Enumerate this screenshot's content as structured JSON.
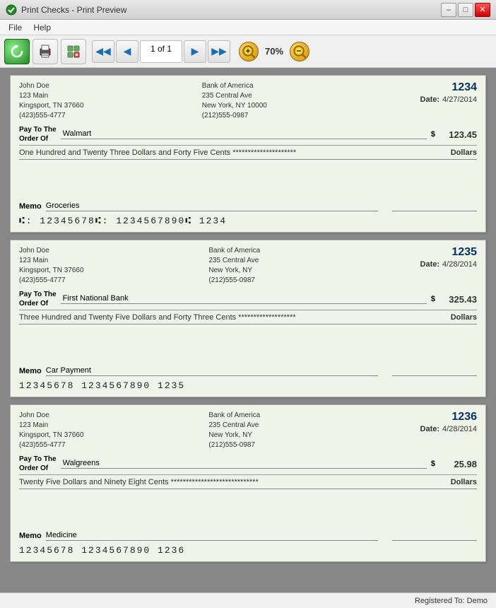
{
  "window": {
    "title": "Print Checks - Print Preview",
    "min_label": "–",
    "max_label": "□",
    "close_label": "✕"
  },
  "menu": {
    "file": "File",
    "help": "Help"
  },
  "toolbar": {
    "page_indicator": "1 of 1",
    "zoom_label": "70%"
  },
  "checks": [
    {
      "sender_name": "John Doe",
      "sender_address1": "123 Main",
      "sender_city": "Kingsport, TN 37660",
      "sender_phone": "(423)555-4777",
      "bank_name": "Bank of America",
      "bank_address1": "235 Central Ave",
      "bank_city": "New York, NY 10000",
      "bank_phone": "(212)555-0987",
      "check_number": "1234",
      "date_label": "Date:",
      "date_value": "4/27/2014",
      "pay_to_label": "Pay To The",
      "order_of_label": "Order Of",
      "payee": "Walmart",
      "dollar_sign": "$",
      "amount": "123.45",
      "written_amount": "One Hundred and Twenty Three Dollars and Forty Five Cents ********************* ",
      "dollars_label": "Dollars",
      "memo_label": "Memo",
      "memo_value": "Groceries",
      "micr": "⑆: 12345678⑆: 1234567890⑆ 1234"
    },
    {
      "sender_name": "John Doe",
      "sender_address1": "123 Main",
      "sender_city": "Kingsport, TN 37660",
      "sender_phone": "(423)555-4777",
      "bank_name": "Bank of America",
      "bank_address1": "235 Central Ave",
      "bank_city": "New York, NY",
      "bank_phone": "(212)555-0987",
      "check_number": "1235",
      "date_label": "Date:",
      "date_value": "4/28/2014",
      "pay_to_label": "Pay To The",
      "order_of_label": "Order Of",
      "payee": "First National Bank",
      "dollar_sign": "$",
      "amount": "325.43",
      "written_amount": "Three Hundred and Twenty Five Dollars and Forty Three Cents ******************* ",
      "dollars_label": "Dollars",
      "memo_label": "Memo",
      "memo_value": "Car Payment",
      "micr": "12345678  1234567890  1235"
    },
    {
      "sender_name": "John Doe",
      "sender_address1": "123 Main",
      "sender_city": "Kingsport, TN 37660",
      "sender_phone": "(423)555-4777",
      "bank_name": "Bank of America",
      "bank_address1": "235 Central Ave",
      "bank_city": "New York, NY",
      "bank_phone": "(212)555-0987",
      "check_number": "1236",
      "date_label": "Date:",
      "date_value": "4/28/2014",
      "pay_to_label": "Pay To The",
      "order_of_label": "Order Of",
      "payee": "Walgreens",
      "dollar_sign": "$",
      "amount": "25.98",
      "written_amount": "Twenty Five Dollars and Ninety Eight Cents ***************************** ",
      "dollars_label": "Dollars",
      "memo_label": "Memo",
      "memo_value": "Medicine",
      "micr": "12345678  1234567890  1236"
    }
  ],
  "status": {
    "text": "Registered To: Demo"
  }
}
